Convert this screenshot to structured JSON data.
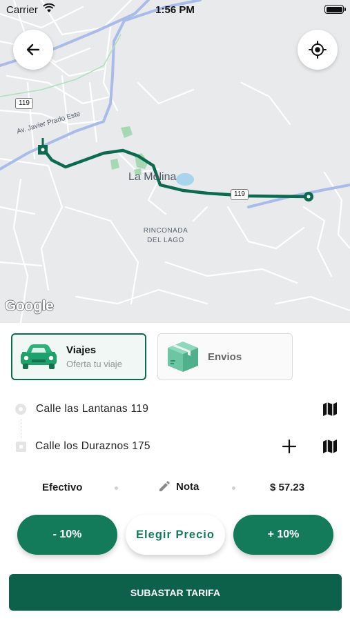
{
  "status_bar": {
    "carrier": "Carrier",
    "time": "1:56 PM"
  },
  "map": {
    "labels": {
      "district": "La Molina",
      "area_line1": "RINCONADA",
      "area_line2": "DEL LAGO",
      "avenue": "Av. Javier Prado Este"
    },
    "route_shields": [
      "119",
      "119"
    ],
    "attribution": "Google",
    "colors": {
      "route": "#0c6a4e",
      "road_major": "#a9bbe8",
      "road_minor": "#ffffff",
      "park": "#a6d8b4",
      "water": "#a8d4ee"
    }
  },
  "buttons": {
    "back_icon": "arrow-left-icon",
    "locate_icon": "crosshair-icon"
  },
  "services": {
    "viajes": {
      "title": "Viajes",
      "subtitle": "Oferta tu viaje",
      "icon": "car-icon",
      "selected": true
    },
    "envios": {
      "title": "Envios",
      "icon": "package-box-icon",
      "selected": false
    }
  },
  "route": {
    "origin": "Calle las Lantanas 119",
    "destination": "Calle los Duraznos 175"
  },
  "meta": {
    "payment": "Efectivo",
    "note": "Nota",
    "price": "$ 57.23"
  },
  "price_controls": {
    "minus": "- 10%",
    "choose": "Elegir Precio",
    "plus": "+ 10%"
  },
  "submit": {
    "label": "SUBASTAR TARIFA"
  },
  "theme": {
    "primary": "#137a5a",
    "primary_dark": "#0d6049"
  }
}
